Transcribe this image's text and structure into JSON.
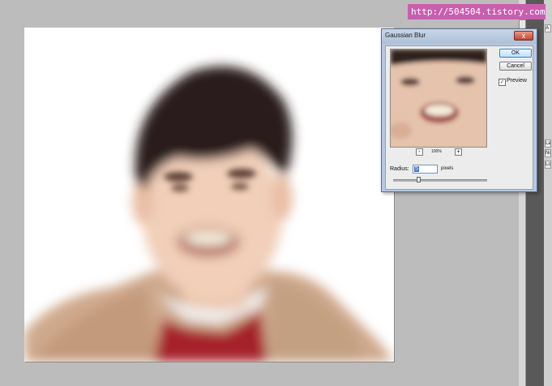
{
  "watermark": "http://504504.tistory.com",
  "dialog": {
    "title": "Gaussian Blur",
    "close_label": "x",
    "ok_label": "OK",
    "cancel_label": "Cancel",
    "preview_label": "Preview",
    "preview_checked": "✓",
    "zoom_out": "-",
    "zoom_in": "+",
    "zoom_level": "100%",
    "radius_label": "Radius:",
    "radius_value": "5",
    "radius_unit": "pixels"
  },
  "dock": {
    "labels": [
      "A",
      "La",
      "No",
      "Lo"
    ]
  },
  "colors": {
    "accent": "#c85fae",
    "dialog_frame": "#b8c8dc",
    "close": "#c5432e"
  }
}
